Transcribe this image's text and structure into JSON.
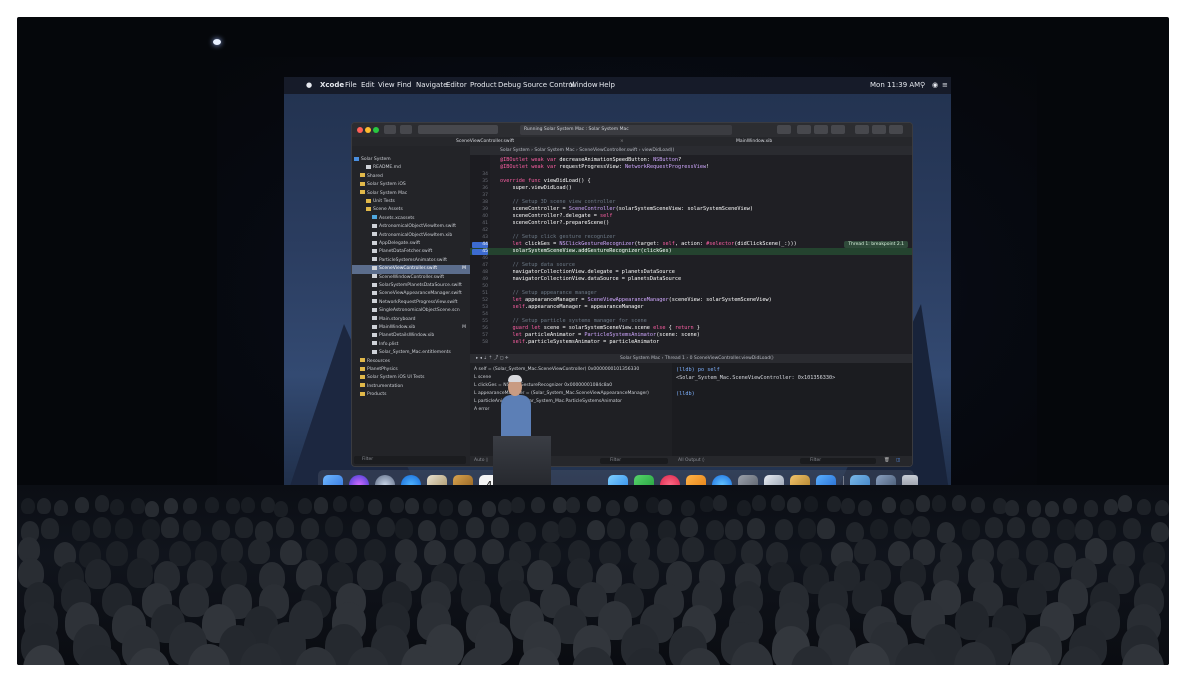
{
  "menubar": {
    "apple": "",
    "app": "Xcode",
    "items": [
      "File",
      "Edit",
      "View",
      "Find",
      "Navigate",
      "Editor",
      "Product",
      "Debug",
      "Source Control",
      "Window",
      "Help"
    ],
    "clock": "Mon 11:39 AM"
  },
  "toolbar": {
    "status": "Running Solar System Mac : Solar System Mac"
  },
  "tabs": {
    "left": "SceneViewController.swift",
    "right": "MainWindow.xib"
  },
  "navigator": {
    "items": [
      {
        "label": "Solar System",
        "type": "project"
      },
      {
        "label": "README.md",
        "type": "file"
      },
      {
        "label": "Shared",
        "type": "folder"
      },
      {
        "label": "Solar System iOS",
        "type": "folder"
      },
      {
        "label": "Solar System Mac",
        "type": "folder"
      },
      {
        "label": "Unit Tests",
        "type": "folder"
      },
      {
        "label": "Scene Assets",
        "type": "folder"
      },
      {
        "label": "Assets.xcassets",
        "type": "asset"
      },
      {
        "label": "AstronomicalObjectViewItem.swift",
        "type": "file"
      },
      {
        "label": "AstronomicalObjectViewItem.xib",
        "type": "file"
      },
      {
        "label": "AppDelegate.swift",
        "type": "file"
      },
      {
        "label": "PlanetDataFetcher.swift",
        "type": "file"
      },
      {
        "label": "ParticleSystemsAnimator.swift",
        "type": "file"
      },
      {
        "label": "SceneViewController.swift",
        "type": "file",
        "badge": "M"
      },
      {
        "label": "SceneWindowController.swift",
        "type": "file"
      },
      {
        "label": "SolarSystemPlanetsDataSource.swift",
        "type": "file"
      },
      {
        "label": "SceneViewAppearanceManager.swift",
        "type": "file"
      },
      {
        "label": "NetworkRequestProgressView.swift",
        "type": "file"
      },
      {
        "label": "SingleAstronomicalObjectScene.scn",
        "type": "file"
      },
      {
        "label": "Main.storyboard",
        "type": "file"
      },
      {
        "label": "MainWindow.xib",
        "type": "file",
        "badge": "M"
      },
      {
        "label": "PlanetDetailsWindow.xib",
        "type": "file"
      },
      {
        "label": "Info.plist",
        "type": "file"
      },
      {
        "label": "Solar_System_Mac.entitlements",
        "type": "file"
      },
      {
        "label": "Resources",
        "type": "folder"
      },
      {
        "label": "PlanetPhysics",
        "type": "folder"
      },
      {
        "label": "Solar System iOS UI Tests",
        "type": "folder"
      },
      {
        "label": "Instrumentation",
        "type": "folder"
      },
      {
        "label": "Products",
        "type": "folder"
      }
    ],
    "filter_placeholder": "Filter"
  },
  "jumpbar": "Solar System  ›  Solar System Mac  ›  SceneViewController.swift  ›  viewDidLoad()",
  "code": {
    "lines": [
      {
        "n": "",
        "text": "@IBOutlet weak var decreaseAnimationSpeedButton: NSButton?"
      },
      {
        "n": "",
        "text": "@IBOutlet weak var requestProgressView: NetworkRequestProgressView!"
      },
      {
        "n": "34",
        "text": ""
      },
      {
        "n": "35",
        "text": "override func viewDidLoad() {"
      },
      {
        "n": "36",
        "text": "    super.viewDidLoad()"
      },
      {
        "n": "37",
        "text": ""
      },
      {
        "n": "38",
        "text": "    // Setup 3D scene view controller"
      },
      {
        "n": "39",
        "text": "    sceneController = SceneController(solarSystemSceneView: solarSystemSceneView)"
      },
      {
        "n": "40",
        "text": "    sceneController?.delegate = self"
      },
      {
        "n": "41",
        "text": "    sceneController?.prepareScene()"
      },
      {
        "n": "42",
        "text": ""
      },
      {
        "n": "43",
        "text": "    // Setup click gesture recognizer"
      },
      {
        "n": "44",
        "text": "    let clickGes = NSClickGestureRecognizer(target: self, action: #selector(didClickScene(_:)))"
      },
      {
        "n": "45",
        "text": "    solarSystemSceneView.addGestureRecognizer(clickGes)"
      },
      {
        "n": "46",
        "text": ""
      },
      {
        "n": "47",
        "text": "    // Setup data source"
      },
      {
        "n": "48",
        "text": "    navigatorCollectionView.delegate = planetsDataSource"
      },
      {
        "n": "49",
        "text": "    navigatorCollectionView.dataSource = planetsDataSource"
      },
      {
        "n": "50",
        "text": ""
      },
      {
        "n": "51",
        "text": "    // Setup appearance manager"
      },
      {
        "n": "52",
        "text": "    let appearanceManager = SceneViewAppearanceManager(sceneView: solarSystemSceneView)"
      },
      {
        "n": "53",
        "text": "    self.appearanceManager = appearanceManager"
      },
      {
        "n": "54",
        "text": ""
      },
      {
        "n": "55",
        "text": "    // Setup particle systems manager for scene"
      },
      {
        "n": "56",
        "text": "    guard let scene = solarSystemSceneView.scene else { return }"
      },
      {
        "n": "57",
        "text": "    let particleAnimator = ParticleSystemsAnimator(scene: scene)"
      },
      {
        "n": "58",
        "text": "    self.particleSystemsAnimator = particleAnimator"
      }
    ],
    "breakpoint_line": "44",
    "current_line": "45",
    "thread_badge": "Thread 1: breakpoint 2.1"
  },
  "debugbar": "Solar System Mac  ›  Thread 1  ›  0 SceneViewController.viewDidLoad()",
  "variables": [
    "A  self = (Solar_System_Mac.SceneViewController) 0x0000000101356330",
    "L  scene",
    "L  clickGes = NSClickGestureRecognizer 0x00000001084c8a0",
    "L  appearanceManager = (Solar_System_Mac.SceneViewAppearanceManager)",
    "L  particleAnimator = Solar_System_Mac.ParticleSystemsAnimator",
    "A  error"
  ],
  "console": {
    "lines": [
      "(lldb) po self",
      "<Solar_System_Mac.SceneViewController: 0x101356330>",
      "",
      "(lldb)"
    ]
  },
  "footer": {
    "auto": "Auto ◊",
    "filter": "Filter",
    "all_output": "All Output ◊",
    "filter2": "Filter"
  },
  "calendar_icon_day": "4",
  "colors": {
    "keyword": "#fc5fa3",
    "type": "#d0a8ff",
    "comment": "#6c7986",
    "plain": "#ffffff",
    "method": "#67b7a4",
    "breakpoint": "#3c6bd0",
    "highlight": "#24432f"
  }
}
